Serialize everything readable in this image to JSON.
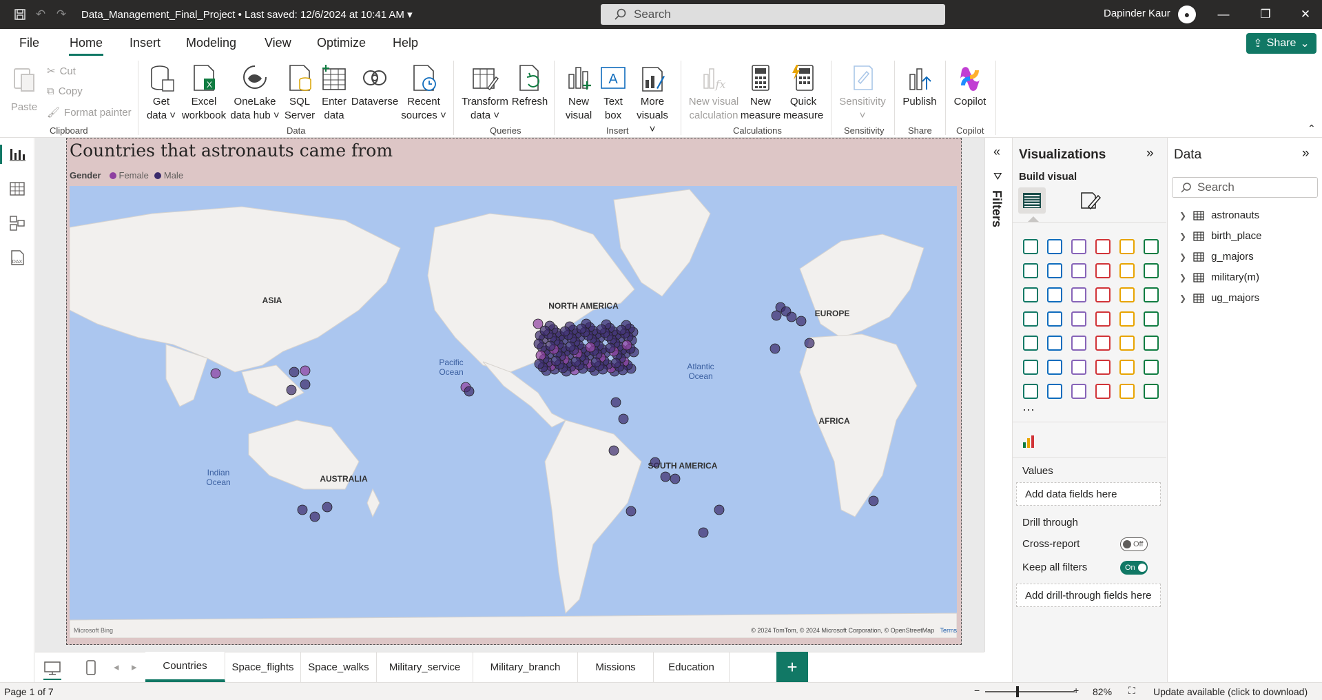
{
  "titlebar": {
    "doc_title": "Data_Management_Final_Project",
    "saved": "• Last saved: 12/6/2024 at 10:41 AM",
    "search_placeholder": "Search",
    "user": "Dapinder Kaur"
  },
  "menu": {
    "items": [
      "File",
      "Home",
      "Insert",
      "Modeling",
      "View",
      "Optimize",
      "Help"
    ],
    "active": "Home",
    "share": "Share"
  },
  "ribbon": {
    "clipboard": {
      "paste": "Paste",
      "cut": "Cut",
      "copy": "Copy",
      "format_painter": "Format painter",
      "label": "Clipboard"
    },
    "data": {
      "get_data": [
        "Get",
        "data ˅"
      ],
      "excel": [
        "Excel",
        "workbook"
      ],
      "onelake": [
        "OneLake",
        "data hub ˅"
      ],
      "sql": [
        "SQL",
        "Server"
      ],
      "enter": [
        "Enter",
        "data"
      ],
      "dataverse": [
        "Dataverse",
        ""
      ],
      "recent": [
        "Recent",
        "sources ˅"
      ],
      "label": "Data"
    },
    "queries": {
      "transform": [
        "Transform",
        "data ˅"
      ],
      "refresh": [
        "Refresh",
        ""
      ],
      "label": "Queries"
    },
    "insert": {
      "new_visual": [
        "New",
        "visual"
      ],
      "text_box": [
        "Text",
        "box"
      ],
      "more": [
        "More",
        "visuals ˅"
      ],
      "label": "Insert"
    },
    "calculations": {
      "new_visual_calc": [
        "New visual",
        "calculation"
      ],
      "new_measure": [
        "New",
        "measure"
      ],
      "quick_measure": [
        "Quick",
        "measure"
      ],
      "label": "Calculations"
    },
    "sensitivity": {
      "btn": [
        "Sensitivity",
        "˅"
      ],
      "label": "Sensitivity"
    },
    "share": {
      "publish": [
        "Publish",
        ""
      ],
      "label": "Share"
    },
    "copilot": {
      "btn": [
        "Copilot",
        ""
      ],
      "label": "Copilot"
    }
  },
  "visual": {
    "title": "Countries that astronauts came from",
    "legend_title": "Gender",
    "legend": [
      {
        "name": "Female",
        "color": "#8e3fa0"
      },
      {
        "name": "Male",
        "color": "#3a2a6b"
      }
    ],
    "map_labels": {
      "asia": "ASIA",
      "north_america": "NORTH AMERICA",
      "europe": "EUROPE",
      "africa": "AFRICA",
      "south_america": "SOUTH AMERICA",
      "australia": "AUSTRALIA",
      "pacific": [
        "Pacific",
        "Ocean"
      ],
      "atlantic": [
        "Atlantic",
        "Ocean"
      ],
      "indian": [
        "Indian",
        "Ocean"
      ]
    },
    "attribution": "© 2024 TomTom, © 2024 Microsoft Corporation, © OpenStreetMap",
    "terms": "Terms",
    "bing": "Microsoft Bing"
  },
  "filters": {
    "label": "Filters"
  },
  "visualizations": {
    "title": "Visualizations",
    "build_visual": "Build visual",
    "more": "···",
    "values_label": "Values",
    "values_placeholder": "Add data fields here",
    "drill_through": "Drill through",
    "cross_report": "Cross-report",
    "cross_report_state": "Off",
    "keep_all_filters": "Keep all filters",
    "keep_all_filters_state": "On",
    "drill_placeholder": "Add drill-through fields here"
  },
  "data_pane": {
    "title": "Data",
    "search_placeholder": "Search",
    "tables": [
      "astronauts",
      "birth_place",
      "g_majors",
      "military(m)",
      "ug_majors"
    ]
  },
  "tabs": {
    "items": [
      "Countries",
      "Space_flights",
      "Space_walks",
      "Military_service",
      "Military_branch",
      "Missions",
      "Education"
    ],
    "active": "Countries",
    "add": "+"
  },
  "status": {
    "page": "Page 1 of 7",
    "zoom": "82%",
    "update": "Update available (click to download)"
  },
  "colors": {
    "accent": "#117865",
    "female": "#8e3fa0",
    "male": "#3a2a6b",
    "ocean": "#abc6ef",
    "land": "#f2f0ee"
  }
}
